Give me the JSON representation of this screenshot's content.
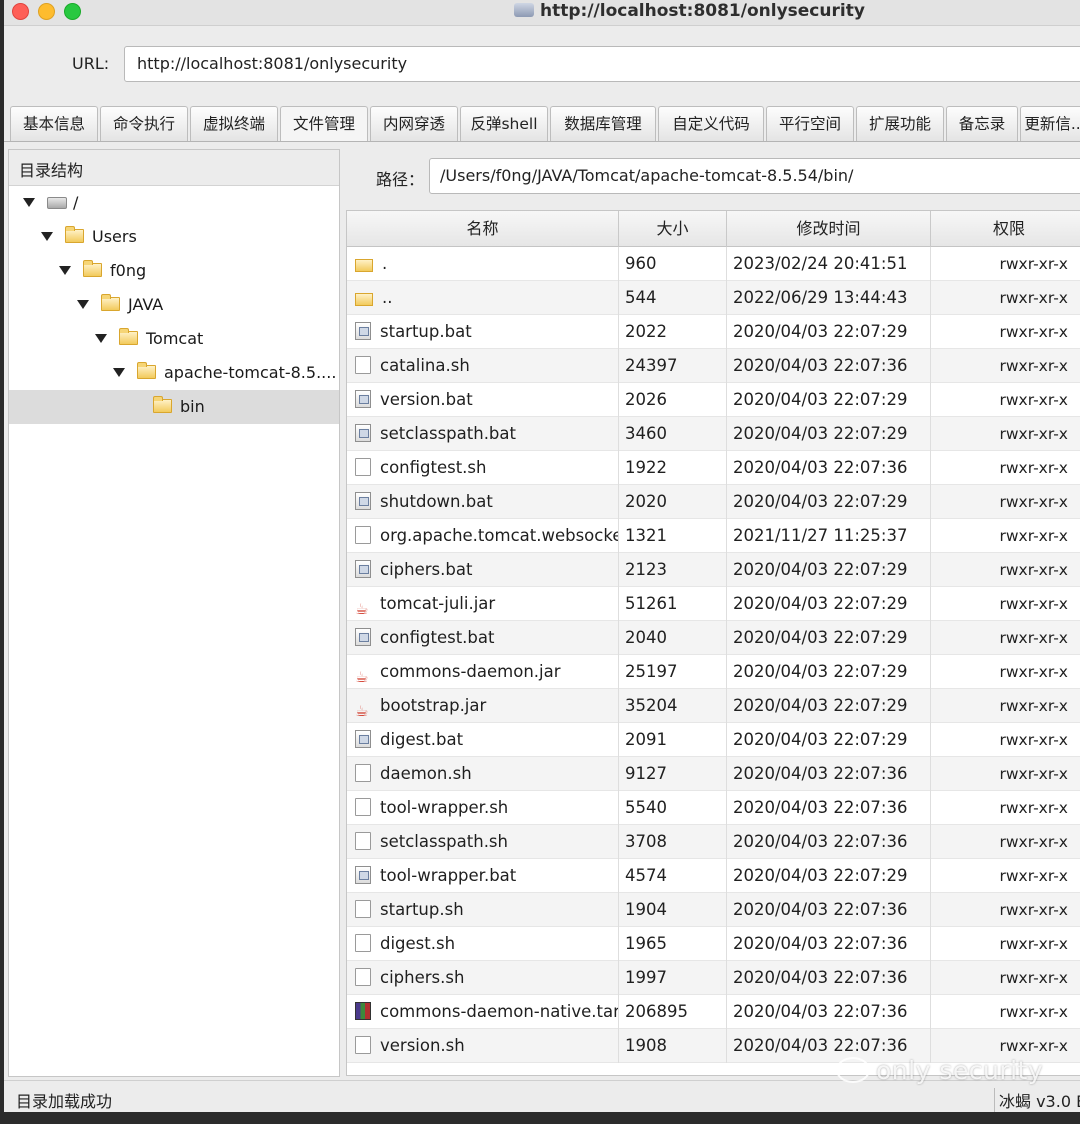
{
  "window": {
    "title": "http://localhost:8081/onlysecurity"
  },
  "url": {
    "label": "URL:",
    "value": "http://localhost:8081/onlysecurity"
  },
  "tabs": [
    {
      "label": "基本信息"
    },
    {
      "label": "命令执行"
    },
    {
      "label": "虚拟终端"
    },
    {
      "label": "文件管理",
      "active": true
    },
    {
      "label": "内网穿透"
    },
    {
      "label": "反弹shell"
    },
    {
      "label": "数据库管理"
    },
    {
      "label": "自定义代码"
    },
    {
      "label": "平行空间"
    },
    {
      "label": "扩展功能"
    },
    {
      "label": "备忘录"
    },
    {
      "label": "更新信..."
    }
  ],
  "tree": {
    "header": "目录结构",
    "nodes": [
      {
        "label": "/",
        "icon": "drive-icon",
        "expanded": true
      },
      {
        "label": "Users",
        "icon": "folder-icon",
        "expanded": true
      },
      {
        "label": "f0ng",
        "icon": "folder-icon",
        "expanded": true
      },
      {
        "label": "JAVA",
        "icon": "folder-icon",
        "expanded": true
      },
      {
        "label": "Tomcat",
        "icon": "folder-icon",
        "expanded": true
      },
      {
        "label": "apache-tomcat-8.5....",
        "icon": "folder-icon",
        "expanded": true
      },
      {
        "label": "bin",
        "icon": "folder-icon",
        "selected": true
      }
    ]
  },
  "path": {
    "label": "路径：",
    "value": "/Users/f0ng/JAVA/Tomcat/apache-tomcat-8.5.54/bin/"
  },
  "table": {
    "columns": [
      "名称",
      "大小",
      "修改时间",
      "权限"
    ],
    "rows": [
      {
        "name": ".",
        "size": "960",
        "time": "2023/02/24 20:41:51",
        "perm": "rwxr-xr-x",
        "type": "dir"
      },
      {
        "name": "..",
        "size": "544",
        "time": "2022/06/29 13:44:43",
        "perm": "rwxr-xr-x",
        "type": "dir"
      },
      {
        "name": "startup.bat",
        "size": "2022",
        "time": "2020/04/03 22:07:29",
        "perm": "rwxr-xr-x",
        "type": "bat"
      },
      {
        "name": "catalina.sh",
        "size": "24397",
        "time": "2020/04/03 22:07:36",
        "perm": "rwxr-xr-x",
        "type": "doc"
      },
      {
        "name": "version.bat",
        "size": "2026",
        "time": "2020/04/03 22:07:29",
        "perm": "rwxr-xr-x",
        "type": "bat"
      },
      {
        "name": "setclasspath.bat",
        "size": "3460",
        "time": "2020/04/03 22:07:29",
        "perm": "rwxr-xr-x",
        "type": "bat"
      },
      {
        "name": "configtest.sh",
        "size": "1922",
        "time": "2020/04/03 22:07:36",
        "perm": "rwxr-xr-x",
        "type": "doc"
      },
      {
        "name": "shutdown.bat",
        "size": "2020",
        "time": "2020/04/03 22:07:29",
        "perm": "rwxr-xr-x",
        "type": "bat"
      },
      {
        "name": "org.apache.tomcat.websocke...",
        "size": "1321",
        "time": "2021/11/27 11:25:37",
        "perm": "rwxr-xr-x",
        "type": "doc"
      },
      {
        "name": "ciphers.bat",
        "size": "2123",
        "time": "2020/04/03 22:07:29",
        "perm": "rwxr-xr-x",
        "type": "bat"
      },
      {
        "name": "tomcat-juli.jar",
        "size": "51261",
        "time": "2020/04/03 22:07:29",
        "perm": "rwxr-xr-x",
        "type": "jar"
      },
      {
        "name": "configtest.bat",
        "size": "2040",
        "time": "2020/04/03 22:07:29",
        "perm": "rwxr-xr-x",
        "type": "bat"
      },
      {
        "name": "commons-daemon.jar",
        "size": "25197",
        "time": "2020/04/03 22:07:29",
        "perm": "rwxr-xr-x",
        "type": "jar"
      },
      {
        "name": "bootstrap.jar",
        "size": "35204",
        "time": "2020/04/03 22:07:29",
        "perm": "rwxr-xr-x",
        "type": "jar"
      },
      {
        "name": "digest.bat",
        "size": "2091",
        "time": "2020/04/03 22:07:29",
        "perm": "rwxr-xr-x",
        "type": "bat"
      },
      {
        "name": "daemon.sh",
        "size": "9127",
        "time": "2020/04/03 22:07:36",
        "perm": "rwxr-xr-x",
        "type": "doc"
      },
      {
        "name": "tool-wrapper.sh",
        "size": "5540",
        "time": "2020/04/03 22:07:36",
        "perm": "rwxr-xr-x",
        "type": "doc"
      },
      {
        "name": "setclasspath.sh",
        "size": "3708",
        "time": "2020/04/03 22:07:36",
        "perm": "rwxr-xr-x",
        "type": "doc"
      },
      {
        "name": "tool-wrapper.bat",
        "size": "4574",
        "time": "2020/04/03 22:07:29",
        "perm": "rwxr-xr-x",
        "type": "bat"
      },
      {
        "name": "startup.sh",
        "size": "1904",
        "time": "2020/04/03 22:07:36",
        "perm": "rwxr-xr-x",
        "type": "doc"
      },
      {
        "name": "digest.sh",
        "size": "1965",
        "time": "2020/04/03 22:07:36",
        "perm": "rwxr-xr-x",
        "type": "doc"
      },
      {
        "name": "ciphers.sh",
        "size": "1997",
        "time": "2020/04/03 22:07:36",
        "perm": "rwxr-xr-x",
        "type": "doc"
      },
      {
        "name": "commons-daemon-native.tar...",
        "size": "206895",
        "time": "2020/04/03 22:07:36",
        "perm": "rwxr-xr-x",
        "type": "tar"
      },
      {
        "name": "version.sh",
        "size": "1908",
        "time": "2020/04/03 22:07:36",
        "perm": "rwxr-xr-x",
        "type": "doc"
      }
    ]
  },
  "status": {
    "left": "目录加载成功",
    "right": "冰蝎 v3.0 B"
  },
  "watermark": "only security"
}
